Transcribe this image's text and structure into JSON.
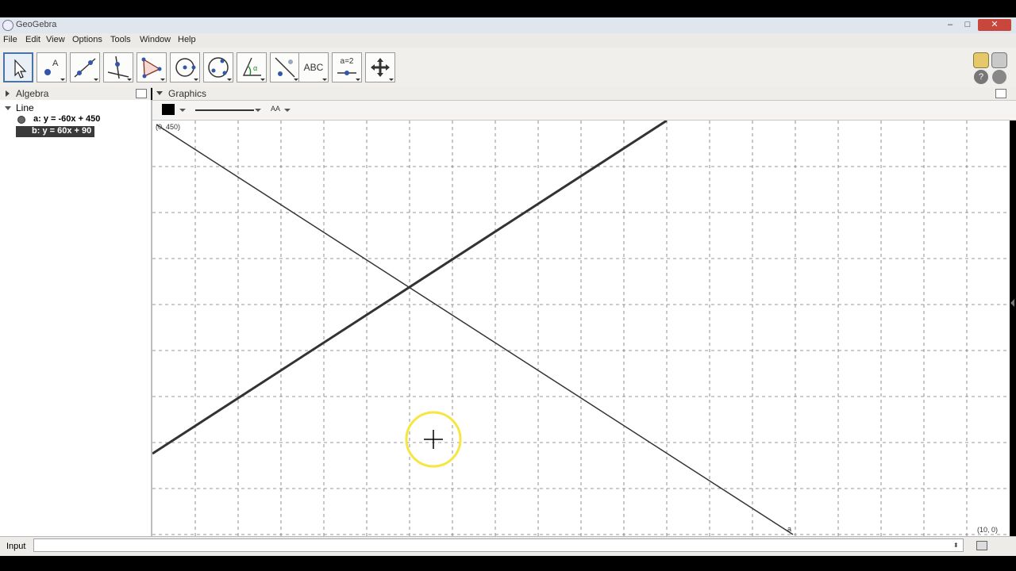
{
  "window": {
    "title": "GeoGebra",
    "controls": [
      "–",
      "□",
      "✕"
    ]
  },
  "menu": [
    "File",
    "Edit",
    "View",
    "Options",
    "Tools",
    "Window",
    "Help"
  ],
  "toolbar": {
    "tools": [
      "move",
      "point",
      "line",
      "perpendicular-line",
      "polygon",
      "circle",
      "conic",
      "angle",
      "reflect",
      "text",
      "slider",
      "move-graphics-view"
    ],
    "active": "move",
    "text_tool_label": "ABC",
    "slider_tool_label": "a=2"
  },
  "algebra": {
    "header": "Algebra",
    "group": "Line",
    "items": [
      {
        "label": "a: y = -60x + 450",
        "selected": false
      },
      {
        "label": "b: y = 60x + 90",
        "selected": true
      }
    ]
  },
  "graphics": {
    "header": "Graphics",
    "style_bar": {
      "color": "#000000",
      "label_style": "AA"
    },
    "labels": {
      "point_top_left": "(0, 450)",
      "point_bottom_right": "(10, 0)",
      "line_a_label": "a"
    },
    "grid": {
      "visible": true,
      "style": "dashed"
    },
    "cursor_highlight": "#f5e642"
  },
  "input": {
    "label": "Input",
    "value": ""
  }
}
